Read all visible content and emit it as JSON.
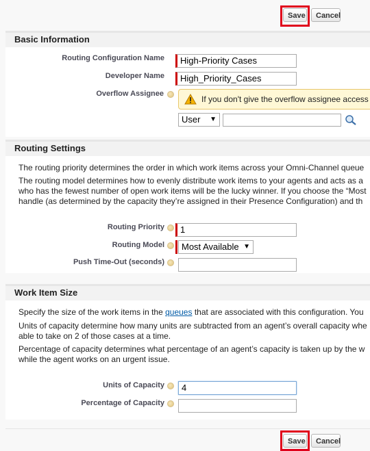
{
  "toolbar": {
    "save_label": "Save",
    "cancel_label": "Cancel"
  },
  "basic": {
    "title": "Basic Information",
    "routing_config_name_label": "Routing Configuration Name",
    "routing_config_name_value": "High-Priority Cases",
    "developer_name_label": "Developer Name",
    "developer_name_value": "High_Priority_Cases",
    "overflow_label": "Overflow Assignee",
    "overflow_warning": "If you don't give the overflow assignee access",
    "assignee_type": "User",
    "assignee_value": ""
  },
  "routing": {
    "title": "Routing Settings",
    "para1": "The routing priority determines the order in which work items across your Omni-Channel queue",
    "para2_line1": "The routing model determines how to evenly distribute work items to your agents and acts as a",
    "para2_line2": "who has the fewest number of open work items will be the lucky winner. If you choose the “Most",
    "para2_line3": "handle (as determined by the capacity they’re assigned in their Presence Configuration) and th",
    "priority_label": "Routing Priority",
    "priority_value": "1",
    "model_label": "Routing Model",
    "model_value": "Most Available",
    "timeout_label": "Push Time-Out (seconds)",
    "timeout_value": ""
  },
  "workitem": {
    "title": "Work Item Size",
    "para1_pre": "Specify the size of the work items in the ",
    "para1_link": "queues",
    "para1_post": " that are associated with this configuration. You",
    "para2_line1": "Units of capacity determine how many units are subtracted from an agent’s overall capacity whe",
    "para2_line2": "able to take on 2 of those cases at a time.",
    "para3_line1": "Percentage of capacity determines what percentage of an agent’s capacity is taken up by the w",
    "para3_line2": "while the agent works on an urgent issue.",
    "units_label": "Units of Capacity",
    "units_value": "4",
    "percent_label": "Percentage of Capacity",
    "percent_value": ""
  },
  "colors": {
    "highlight": "#e0001b",
    "required": "#cc0000",
    "link": "#015ba7"
  },
  "icons": {
    "help": "help-icon",
    "warning": "warning-icon",
    "lookup": "lookup-icon"
  }
}
